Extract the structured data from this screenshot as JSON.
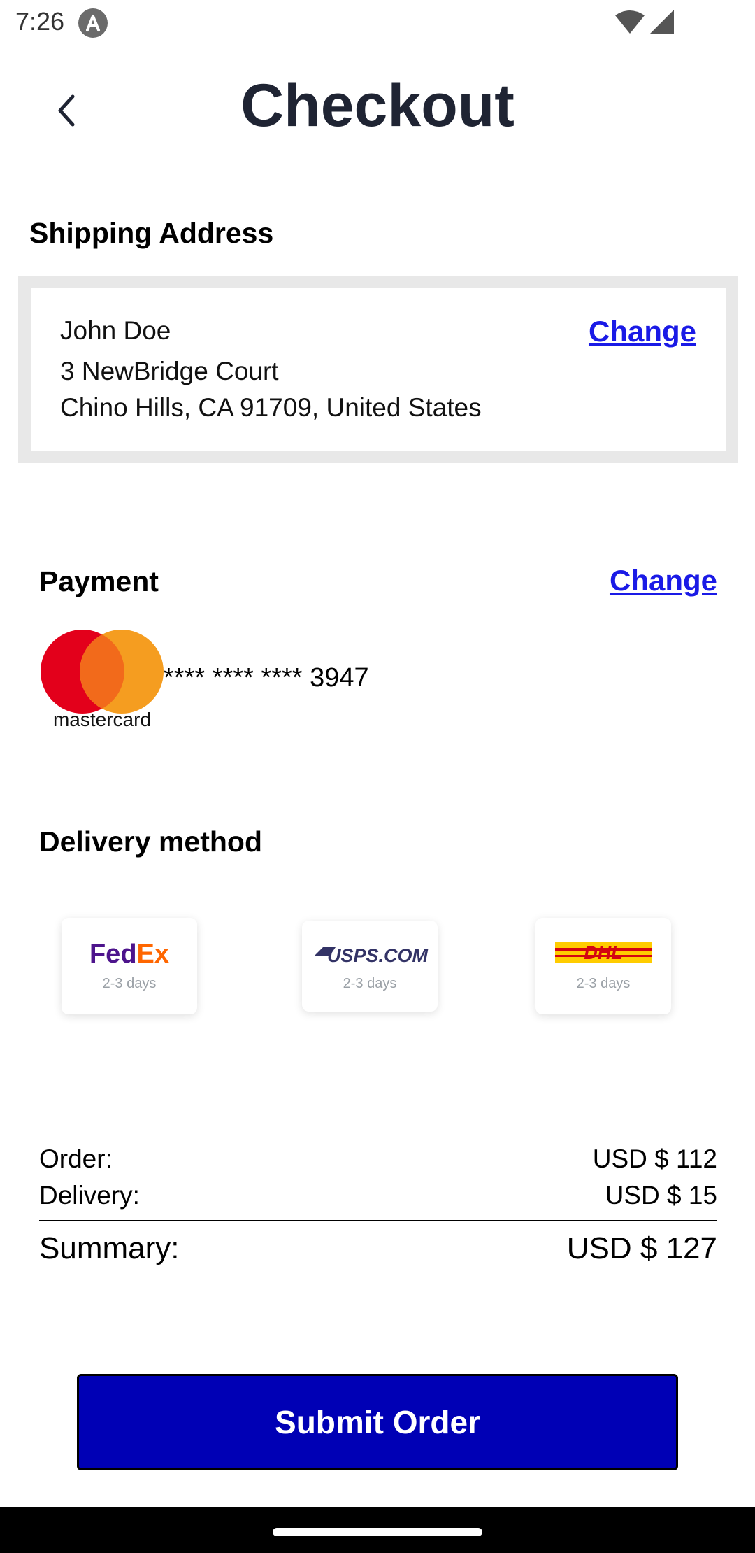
{
  "status_bar": {
    "time": "7:26"
  },
  "header": {
    "title": "Checkout"
  },
  "shipping": {
    "title": "Shipping Address",
    "name": "John Doe",
    "line1": "3 NewBridge Court",
    "line2": "Chino Hills, CA 91709, United States",
    "change_label": "Change"
  },
  "payment": {
    "title": "Payment",
    "change_label": "Change",
    "card_brand": "mastercard",
    "card_number": "**** **** **** 3947"
  },
  "delivery": {
    "title": "Delivery method",
    "options": [
      {
        "carrier": "FedEx",
        "days": "2-3 days"
      },
      {
        "carrier": "USPS.COM",
        "days": "2-3 days"
      },
      {
        "carrier": "DHL",
        "days": "2-3 days"
      }
    ]
  },
  "summary": {
    "order_label": "Order:",
    "order_value": "USD $ 112",
    "delivery_label": "Delivery:",
    "delivery_value": "USD $ 15",
    "total_label": "Summary:",
    "total_value": "USD $ 127"
  },
  "submit_label": "Submit Order",
  "colors": {
    "accent": "#0000b5",
    "link": "#1a1ae6",
    "title": "#1f2433"
  }
}
